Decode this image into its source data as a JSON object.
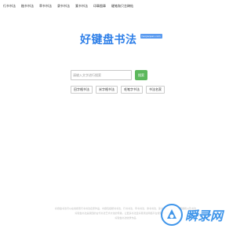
{
  "topnav": {
    "items": [
      "行书书法",
      "楷书书法",
      "草书书法",
      "隶书书法",
      "篆书书法",
      "印章图章",
      "硬笔和只言碑帖"
    ]
  },
  "logo": {
    "title": "好键盘书法",
    "badge": "haojianpan.com"
  },
  "search": {
    "placeholder": "请输入文字进行搜索",
    "button_label": "搜索"
  },
  "font_tabs": [
    "田字格书法",
    "米字格书法",
    "毛笔字书法",
    "书法名家"
  ],
  "footer": {
    "line1": "好键盘书法可以在线搜索行书书法名家作品，内容包括楷书书法、行书书法、草书书法、隶书书法、篆书书法、篆刻印章图章和以及书法",
    "line2": "好键盘书法是我国的古代书法艺术文化的传播，让更多书法爱好者通过网络平台搜索学习书法作品",
    "line3": "好键盘书法收录作品"
  },
  "watermark": {
    "text": "瞬录网"
  },
  "colors": {
    "brand_blue": "#2e7fe8",
    "search_green": "#5cb85c"
  }
}
